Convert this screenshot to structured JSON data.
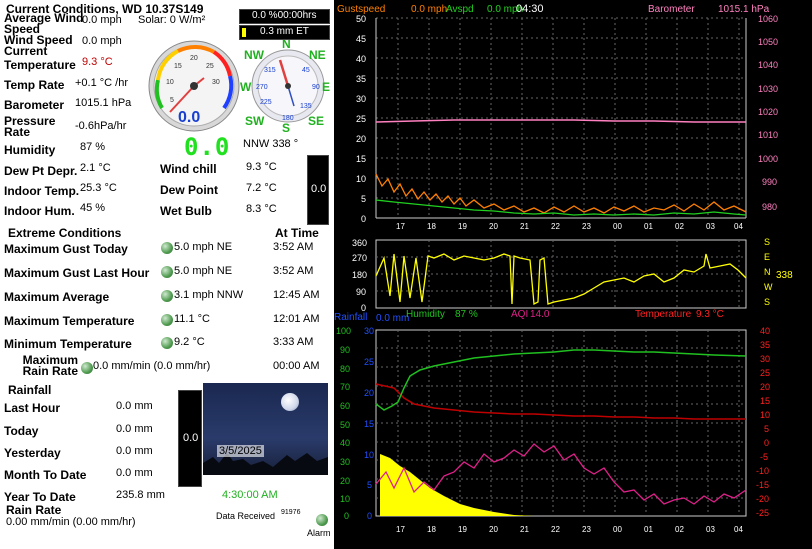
{
  "title": "Current Conditions, WD 10.37S149",
  "current": {
    "avg_wind_label": "Average Wind Speed",
    "avg_wind": "0.0 mph",
    "solar": "Solar: 0 W/m²",
    "cur_wind_label": "Wind Speed Current",
    "cur_wind": "0.0 mph",
    "temp_label": "Temperature",
    "temp": "9.3 °C",
    "temprate_label": "Temp Rate",
    "temprate": "+0.1 °C /hr",
    "baro_label": "Barometer",
    "baro": "1015.1 hPa",
    "prate_label": "Pressure Rate",
    "prate": "-0.6hPa/hr",
    "hum_label": "Humidity",
    "hum": "87 %",
    "dew_dep_label": "Dew Pt Depr.",
    "dew_dep": "2.1 °C",
    "indoor_temp_label": "Indoor Temp.",
    "indoor_temp": "25.3 °C",
    "indoor_hum_label": "Indoor Hum.",
    "indoor_hum": "45 %",
    "windchill_label": "Wind chill",
    "windchill": "9.3 °C",
    "dewpoint_label": "Dew Point",
    "dewpoint": "7.2 °C",
    "wetbulb_label": "Wet Bulb",
    "wetbulb": "8.3 °C"
  },
  "gauge": {
    "value": "0.0",
    "ticks": [
      "5",
      "10",
      "15",
      "20",
      "25",
      "30"
    ],
    "digital": "0.0",
    "rain_box": "0.0"
  },
  "compass": {
    "n": "N",
    "ne": "NE",
    "e": "E",
    "se": "SE",
    "s": "S",
    "sw": "SW",
    "w": "W",
    "nw": "NW",
    "heading": "NNW 338 °",
    "ticks": [
      "315",
      "45",
      "135",
      "225",
      "270",
      "90",
      "180"
    ]
  },
  "topbox": {
    "time": "0.0 %00:00hrs",
    "et": "0.3 mm ET"
  },
  "extremes": {
    "header": "Extreme Conditions",
    "at_time": "At Time",
    "rows": [
      {
        "label": "Maximum Gust Today",
        "value": "5.0 mph  NE",
        "time": "3:52 AM"
      },
      {
        "label": "Maximum Gust Last Hour",
        "value": "5.0 mph  NE",
        "time": "3:52 AM"
      },
      {
        "label": "Maximum Average",
        "value": "3.1 mph NNW",
        "time": "12:45 AM"
      },
      {
        "label": "Maximum Temperature",
        "value": "11.1 °C",
        "time": "12:01 AM"
      },
      {
        "label": "Minimum Temperature",
        "value": "9.2 °C",
        "time": "3:33 AM"
      },
      {
        "label": "Maximum Rain Rate",
        "value": "0.0 mm/min (0.0 mm/hr)",
        "time": "00:00 AM"
      }
    ]
  },
  "rain": {
    "header": "Rainfall",
    "rows": [
      {
        "label": "Last Hour",
        "value": "0.0 mm"
      },
      {
        "label": "Today",
        "value": "0.0 mm"
      },
      {
        "label": "Yesterday",
        "value": "0.0 mm"
      },
      {
        "label": "Month To Date",
        "value": "0.0 mm"
      },
      {
        "label": "Year To Date",
        "value": "235.8 mm"
      }
    ],
    "rate_label": "Rain Rate",
    "rate": "0.00 mm/min (0.00 mm/hr)",
    "box_value": "0.0"
  },
  "sky": {
    "date": "3/5/2025",
    "time": "4:30:00 AM"
  },
  "footer": {
    "data_received": "Data Received",
    "count": "91976",
    "alarm": "Alarm"
  },
  "graph1": {
    "gust": "Gustspeed",
    "gust_val": "0.0 mph",
    "avg": "Avspd",
    "avg_val": "0.0 mph",
    "time": "04:30",
    "baro": "Barometer",
    "baro_val": "1015.1 hPa",
    "left_ticks": [
      "50",
      "45",
      "40",
      "35",
      "30",
      "25",
      "20",
      "15",
      "10",
      "5",
      "0"
    ],
    "right_ticks": [
      "1060",
      "1050",
      "1040",
      "1030",
      "1020",
      "1010",
      "1000",
      "990",
      "980"
    ],
    "hours": [
      "17",
      "18",
      "19",
      "20",
      "21",
      "22",
      "23",
      "00",
      "01",
      "02",
      "03",
      "04"
    ]
  },
  "graph2": {
    "ticks": [
      "360",
      "270",
      "180",
      "90",
      "0"
    ],
    "letters": [
      "S",
      "E",
      "N",
      "W",
      "S"
    ],
    "heading": "338"
  },
  "graph3": {
    "humidity": "Humidity",
    "humidity_val": "87 %",
    "aqi": "AQI",
    "aqi_val": "14.0",
    "temp": "Temperature",
    "temp_val": "9.3 °C",
    "rainfall": "Rainfall",
    "rainfall_val": "0.0 mm",
    "left_ticks": [
      "100",
      "90",
      "80",
      "70",
      "60",
      "50",
      "40",
      "30",
      "20",
      "10",
      "0"
    ],
    "left2_ticks": [
      "30",
      "25",
      "20",
      "15",
      "10",
      "5",
      "0"
    ],
    "right_ticks": [
      "40",
      "35",
      "30",
      "25",
      "20",
      "15",
      "10",
      "5",
      "0",
      "-5",
      "-10",
      "-15",
      "-20",
      "-25"
    ]
  },
  "colors": {
    "gust": "#ff8000",
    "avg": "#20d020",
    "baro": "#ff80c0",
    "wind_dir": "#ffff00",
    "humidity": "#20c020",
    "temp": "#c00000",
    "aqi": "#e0208a",
    "rain": "#ffff00"
  }
}
